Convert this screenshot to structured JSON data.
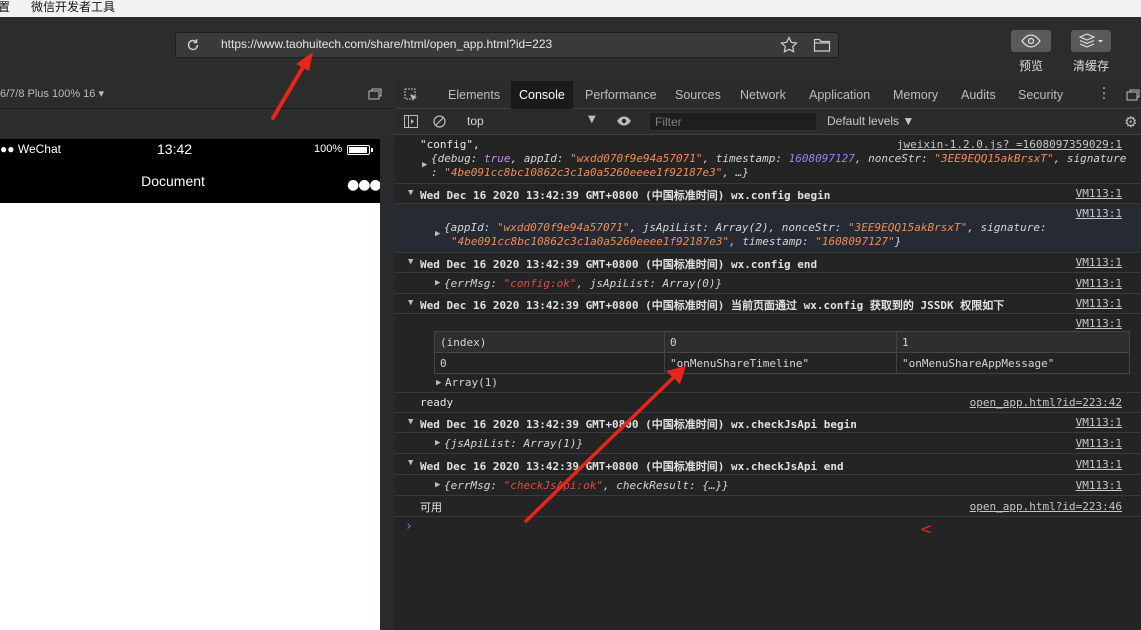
{
  "menubar": {
    "item_settings": "设置",
    "item_devtools": "微信开发者工具"
  },
  "toolbar": {
    "url": "https://www.taohuitech.com/share/html/open_app.html?id=223",
    "preview_label": "预览",
    "clear_cache_label": "清缓存"
  },
  "simulator": {
    "device": "6/7/8 Plus 100% 16",
    "carrier": "WeChat",
    "time": "13:42",
    "battery": "100%",
    "nav_title": "Document"
  },
  "devtools": {
    "tabs": [
      "Elements",
      "Console",
      "Performance",
      "Sources",
      "Network",
      "Application",
      "Memory",
      "Audits",
      "Security"
    ],
    "active_tab": "Console",
    "context": "top",
    "filter_placeholder": "Filter",
    "levels": "Default levels ▼"
  },
  "console": {
    "l1_text": "\"config\",",
    "l1_src": "jweixin-1.2.0.js? =1608097359029:1",
    "l1_obj_a": "{debug: ",
    "l1_debug": "true",
    "l1_obj_b": ", appId: ",
    "l1_appid": "\"wxdd070f9e94a57071\"",
    "l1_obj_c": ", timestamp: ",
    "l1_ts": "1608097127",
    "l1_obj_d": ", nonceStr: ",
    "l1_nonce": "\"3EE9EQQ15akBrsxT\"",
    "l1_obj_e": ", signature",
    "l1_cont_a": ": ",
    "l1_sig": "\"4be091cc8bc10862c3c1a0a5260eeee1f92187e3\"",
    "l1_cont_b": ", …}",
    "g1_title": "Wed Dec 16 2020 13:42:39 GMT+0800 (中国标准时间) wx.config begin",
    "g1_src": "VM113:1",
    "g1_item_src": "VM113:1",
    "g1_obj_a": "{appId: ",
    "g1_appid": "\"wxdd070f9e94a57071\"",
    "g1_obj_b": ", jsApiList: Array(2), nonceStr: ",
    "g1_nonce": "\"3EE9EQQ15akBrsxT\"",
    "g1_obj_c": ", signature:",
    "g1_sig": "\"4be091cc8bc10862c3c1a0a5260eeee1f92187e3\"",
    "g1_obj_d": ", timestamp: ",
    "g1_ts": "\"1608097127\"",
    "g1_obj_e": "}",
    "g2_title": "Wed Dec 16 2020 13:42:39 GMT+0800 (中国标准时间) wx.config end",
    "g2_src": "VM113:1",
    "g2_obj_a": "{errMsg: ",
    "g2_err": "\"config:ok\"",
    "g2_obj_b": ", jsApiList: Array(0)}",
    "g2_item_src": "VM113:1",
    "g3_title": "Wed Dec 16 2020 13:42:39 GMT+0800 (中国标准时间) 当前页面通过 wx.config 获取到的 JSSDK 权限如下",
    "g3_src": "VM113:1",
    "g3_item_src": "VM113:1",
    "table": {
      "header": [
        "(index)",
        "0",
        "1"
      ],
      "row": [
        "0",
        "\"onMenuShareTimeline\"",
        "\"onMenuShareAppMessage\""
      ]
    },
    "g3_array": "Array(1)",
    "ready_text": "ready",
    "ready_src": "open_app.html?id=223:42",
    "g4_title": "Wed Dec 16 2020 13:42:39 GMT+0800 (中国标准时间) wx.checkJsApi begin",
    "g4_src": "VM113:1",
    "g4_obj": "{jsApiList: Array(1)}",
    "g4_item_src": "VM113:1",
    "g5_title": "Wed Dec 16 2020 13:42:39 GMT+0800 (中国标准时间) wx.checkJsApi end",
    "g5_src": "VM113:1",
    "g5_obj_a": "{errMsg: ",
    "g5_err": "\"checkJsApi:ok\"",
    "g5_obj_b": ", checkResult: {…}}",
    "g5_item_src": "VM113:1",
    "usable_text": "可用",
    "usable_src": "open_app.html?id=223:46",
    "prompt": "›",
    "mark": "<"
  },
  "colors": {
    "annotation": "#e8251b",
    "string": "#f28b54",
    "number": "#9980ff",
    "prompt": "#4e93ff"
  },
  "icons": [
    "reload-icon",
    "star-icon",
    "folder-icon",
    "eye-icon",
    "layers-icon",
    "inspect-icon",
    "clear-icon",
    "gear-icon"
  ]
}
